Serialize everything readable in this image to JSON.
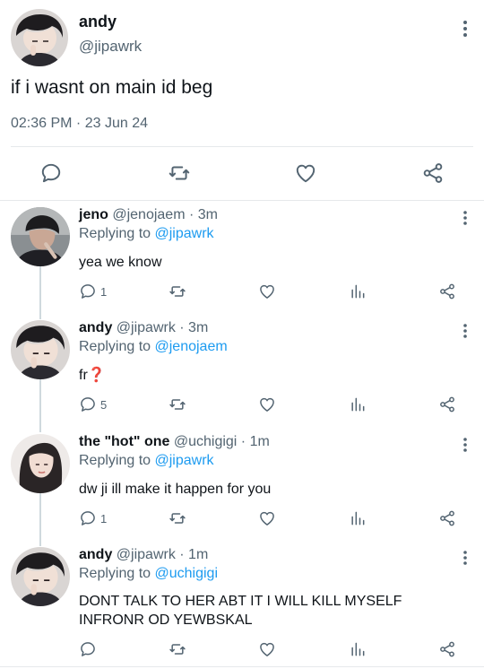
{
  "main": {
    "name": "andy",
    "handle": "@jipawrk",
    "text": "if i wasnt on main id beg",
    "timestamp": "02:36 PM · 23 Jun 24"
  },
  "replies": [
    {
      "name": "jeno",
      "handle": "@jenojaem",
      "time": "3m",
      "replying_prefix": "Replying to",
      "replying_to": "@jipawrk",
      "text": "yea we know",
      "reply_count": "1"
    },
    {
      "name": "andy",
      "handle": "@jipawrk",
      "time": "3m",
      "replying_prefix": "Replying to",
      "replying_to": "@jenojaem",
      "text": "fr❓",
      "reply_count": "5"
    },
    {
      "name": "the \"hot\" one",
      "handle": "@uchigigi",
      "time": "1m",
      "replying_prefix": "Replying to",
      "replying_to": "@jipawrk",
      "text": "dw ji ill make it happen for you",
      "reply_count": "1"
    },
    {
      "name": "andy",
      "handle": "@jipawrk",
      "time": "1m",
      "replying_prefix": "Replying to",
      "replying_to": "@uchigigi",
      "text_lines": [
        "DONT TALK TO HER ABT IT I WILL KILL MYSELF",
        "INFRONR OD YEWBSKAL"
      ],
      "reply_count": ""
    }
  ],
  "sep": " · ",
  "colors": {
    "accent": "#1d9bf0",
    "muted": "#536471",
    "text": "#0f1419"
  },
  "icons": [
    "reply-icon",
    "retweet-icon",
    "like-icon",
    "share-icon",
    "views-icon",
    "more-icon"
  ]
}
